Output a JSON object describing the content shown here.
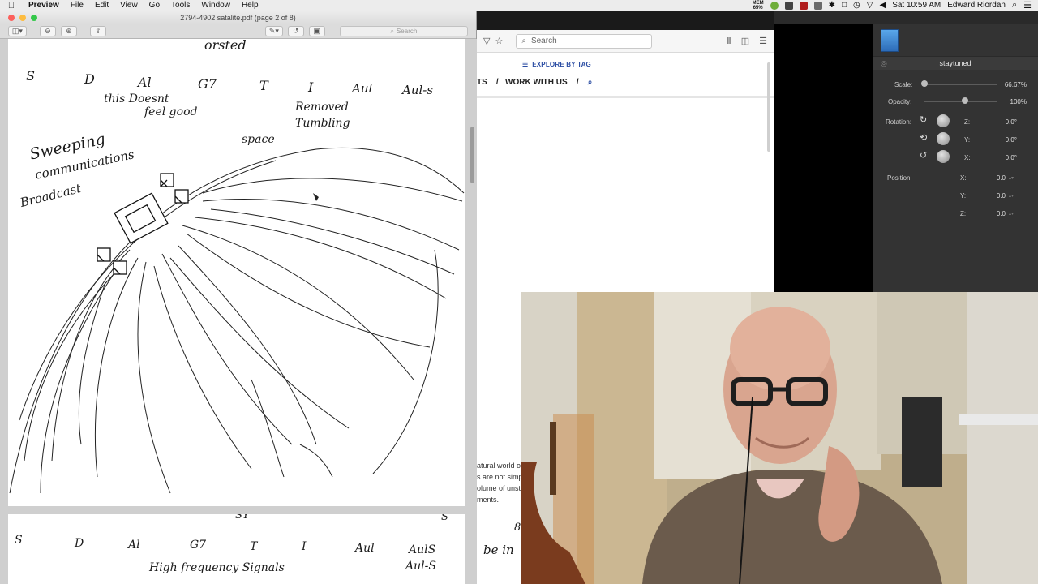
{
  "menubar": {
    "app": "Preview",
    "items": [
      "File",
      "Edit",
      "View",
      "Go",
      "Tools",
      "Window",
      "Help"
    ],
    "mem_top": "MEM",
    "mem_pct": "65%",
    "clock": "Sat 10:59 AM",
    "user": "Edward Riordan"
  },
  "preview": {
    "title": "2794-4902 satalite.pdf (page 2 of 8)",
    "search_placeholder": "Search"
  },
  "notes_page1": {
    "top": "orsted",
    "row": [
      "S",
      "D",
      "Al",
      "G7",
      "T",
      "I",
      "Aul",
      "Aul-s"
    ],
    "note1a": "this Doesnt",
    "note1b": "feel good",
    "note2a": "Removed",
    "note2b": "Tumbling",
    "space": "space",
    "side1": "Sweeping",
    "side2": "communications",
    "side3": "Broadcast"
  },
  "notes_page2": {
    "top": "SY",
    "top_right": "S",
    "row": [
      "S",
      "D",
      "Al",
      "G7",
      "T",
      "I",
      "Aul",
      "AulS"
    ],
    "bottom": "High frequency Signals",
    "bottom_right": "Aul-S"
  },
  "browser": {
    "search_placeholder": "Search",
    "explore": "EXPLORE BY TAG",
    "nav_left": "TS",
    "nav_sep": "/",
    "nav_work": "WORK WITH US",
    "text_lines": [
      "atural world o",
      "s are not simp",
      "olume of unst",
      "ments."
    ],
    "side_frag1": "be in",
    "side_frag2": "8"
  },
  "inspector": {
    "name": "staytuned",
    "scale_label": "Scale:",
    "scale_value": "66.67%",
    "scale_fraction": 0.6667,
    "opacity_label": "Opacity:",
    "opacity_value": "100%",
    "opacity_fraction": 1.0,
    "rotation_label": "Rotation:",
    "rot_z_label": "Z:",
    "rot_z": "0.0°",
    "rot_y_label": "Y:",
    "rot_y": "0.0°",
    "rot_x_label": "X:",
    "rot_x": "0.0°",
    "position_label": "Position:",
    "pos_x_label": "X:",
    "pos_x": "0.0",
    "pos_y_label": "Y:",
    "pos_y": "0.0",
    "pos_z_label": "Z:",
    "pos_z": "0.0"
  },
  "colors": {
    "close": "#fc605c",
    "minimize": "#fdbc40",
    "zoom": "#34c84a",
    "link_blue": "#2b4da3"
  }
}
